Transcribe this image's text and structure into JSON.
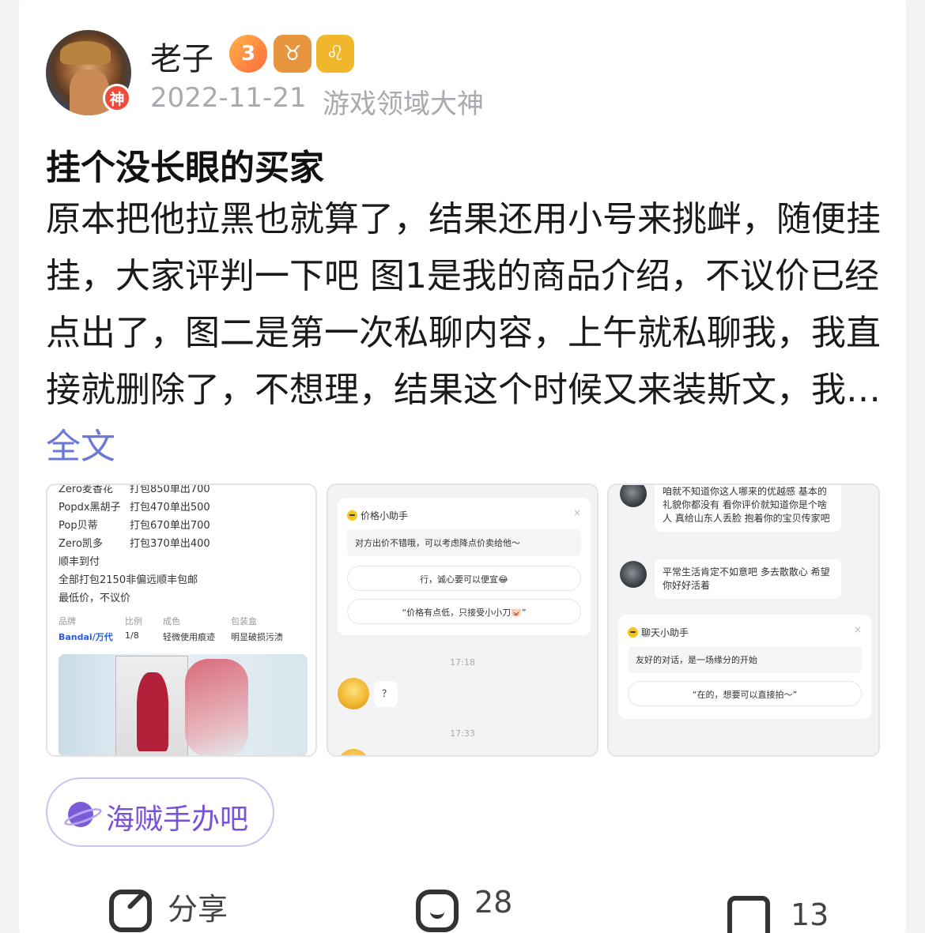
{
  "author": {
    "name": "老子",
    "avatar_badge": "神",
    "badges": [
      {
        "name": "level-badge",
        "text": "3"
      },
      {
        "name": "taurus-badge",
        "text": "♉"
      },
      {
        "name": "leo-badge",
        "text": "♌"
      }
    ],
    "date": "2022-11-21",
    "tag": "游戏领域大神"
  },
  "post": {
    "title": "挂个没长眼的买家",
    "body": "原本把他拉黑也就算了，结果还用小号来挑衅，随便挂挂，大家评判一下吧 图1是我的商品介绍，不议价已经点出了，图二是第一次私聊内容，上午就私聊我，我直接就删除了，不想理，结果这个时候又来装斯文，我…",
    "full_text_link": "全文"
  },
  "image1": {
    "lines": [
      {
        "name": "Zero麦香花",
        "value": "打包850单出700"
      },
      {
        "name": "Popdx黑胡子",
        "value": "打包470单出500"
      },
      {
        "name": "Pop贝蒂",
        "value": "打包670单出700"
      },
      {
        "name": "Zero凯多",
        "value": "打包370单出400"
      }
    ],
    "shipping": "顺丰到付",
    "bundle": "全部打包2150非偏远顺丰包邮",
    "lowest": "最低价，不议价",
    "specs": {
      "headers": [
        "品牌",
        "比例",
        "成色",
        "包装盒"
      ],
      "values": [
        "Bandai/万代",
        "1/8",
        "轻微使用痕迹",
        "明显破损污渍"
      ]
    }
  },
  "image2": {
    "helper_title": "价格小助手",
    "helper_msg": "对方出价不错哦，可以考虑降点价卖给他～",
    "suggestions": [
      "行，诚心要可以便宜😂",
      "“价格有点低，只接受小小刀🐷”"
    ],
    "time1": "17:18",
    "msg1": "？",
    "time2": "17:33"
  },
  "image3": {
    "msg1": "咱就不知道你这人哪来的优越感 基本的礼貌你都没有 看你评价就知道你是个啥人 真给山东人丢脸 抱着你的宝贝传家吧",
    "msg2": "平常生活肯定不如意吧 多去散散心 希望你好好活着",
    "helper_title": "聊天小助手",
    "helper_msg": "友好的对话，是一场缘分的开始",
    "suggestion": "“在的，想要可以直接拍～”"
  },
  "community": {
    "name": "海贼手办吧"
  },
  "actions": {
    "share_label": "分享",
    "comment_count": "28",
    "like_count": "13"
  },
  "colors": {
    "link": "#6a78d8",
    "community": "#7a52d6",
    "brand_blue": "#2b5bd8",
    "meta_grey": "#a9a9b0"
  }
}
